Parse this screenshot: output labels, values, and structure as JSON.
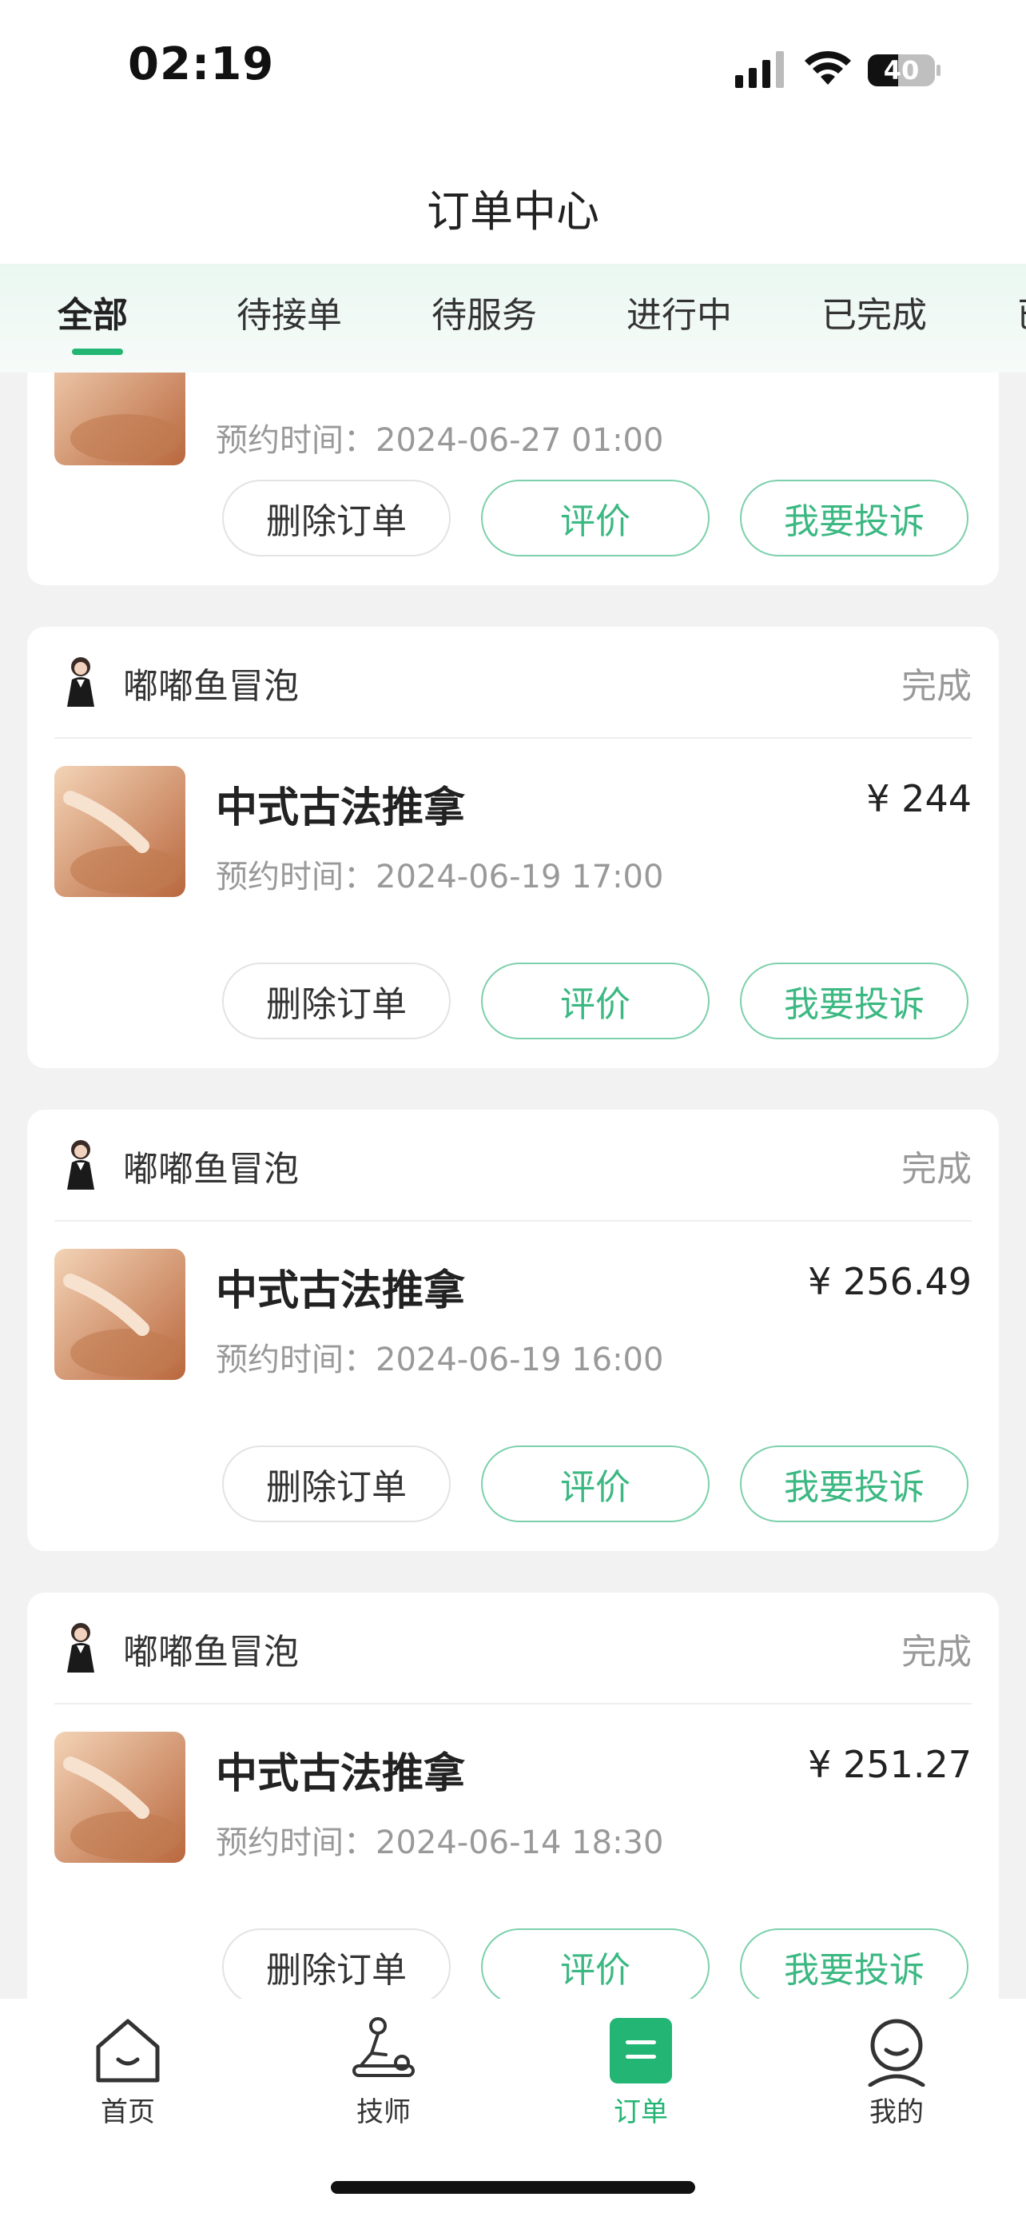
{
  "status_bar": {
    "time": "02:19",
    "battery": "40"
  },
  "header": {
    "title": "订单中心"
  },
  "tabs": [
    "全部",
    "待接单",
    "待服务",
    "进行中",
    "已完成",
    "已"
  ],
  "orders": [
    {
      "merchant": "",
      "status": "",
      "service": "",
      "price": "",
      "appointment": "预约时间：2024-06-27 01:00",
      "actions": [
        "删除订单",
        "评价",
        "我要投诉"
      ]
    },
    {
      "merchant": "嘟嘟鱼冒泡",
      "status": "完成",
      "service": "中式古法推拿",
      "price": "¥ 244",
      "appointment": "预约时间：2024-06-19 17:00",
      "actions": [
        "删除订单",
        "评价",
        "我要投诉"
      ]
    },
    {
      "merchant": "嘟嘟鱼冒泡",
      "status": "完成",
      "service": "中式古法推拿",
      "price": "¥ 256.49",
      "appointment": "预约时间：2024-06-19 16:00",
      "actions": [
        "删除订单",
        "评价",
        "我要投诉"
      ]
    },
    {
      "merchant": "嘟嘟鱼冒泡",
      "status": "完成",
      "service": "中式古法推拿",
      "price": "¥ 251.27",
      "appointment": "预约时间：2024-06-14 18:30",
      "actions": [
        "删除订单",
        "评价",
        "我要投诉"
      ]
    }
  ],
  "nav": [
    {
      "label": "首页",
      "icon": "home-icon"
    },
    {
      "label": "技师",
      "icon": "massage-therapist-icon"
    },
    {
      "label": "订单",
      "icon": "order-icon",
      "active": true
    },
    {
      "label": "我的",
      "icon": "profile-icon"
    }
  ],
  "colors": {
    "accent": "#22b573",
    "accent_light": "#7dd0ab",
    "muted_text": "#999999"
  }
}
